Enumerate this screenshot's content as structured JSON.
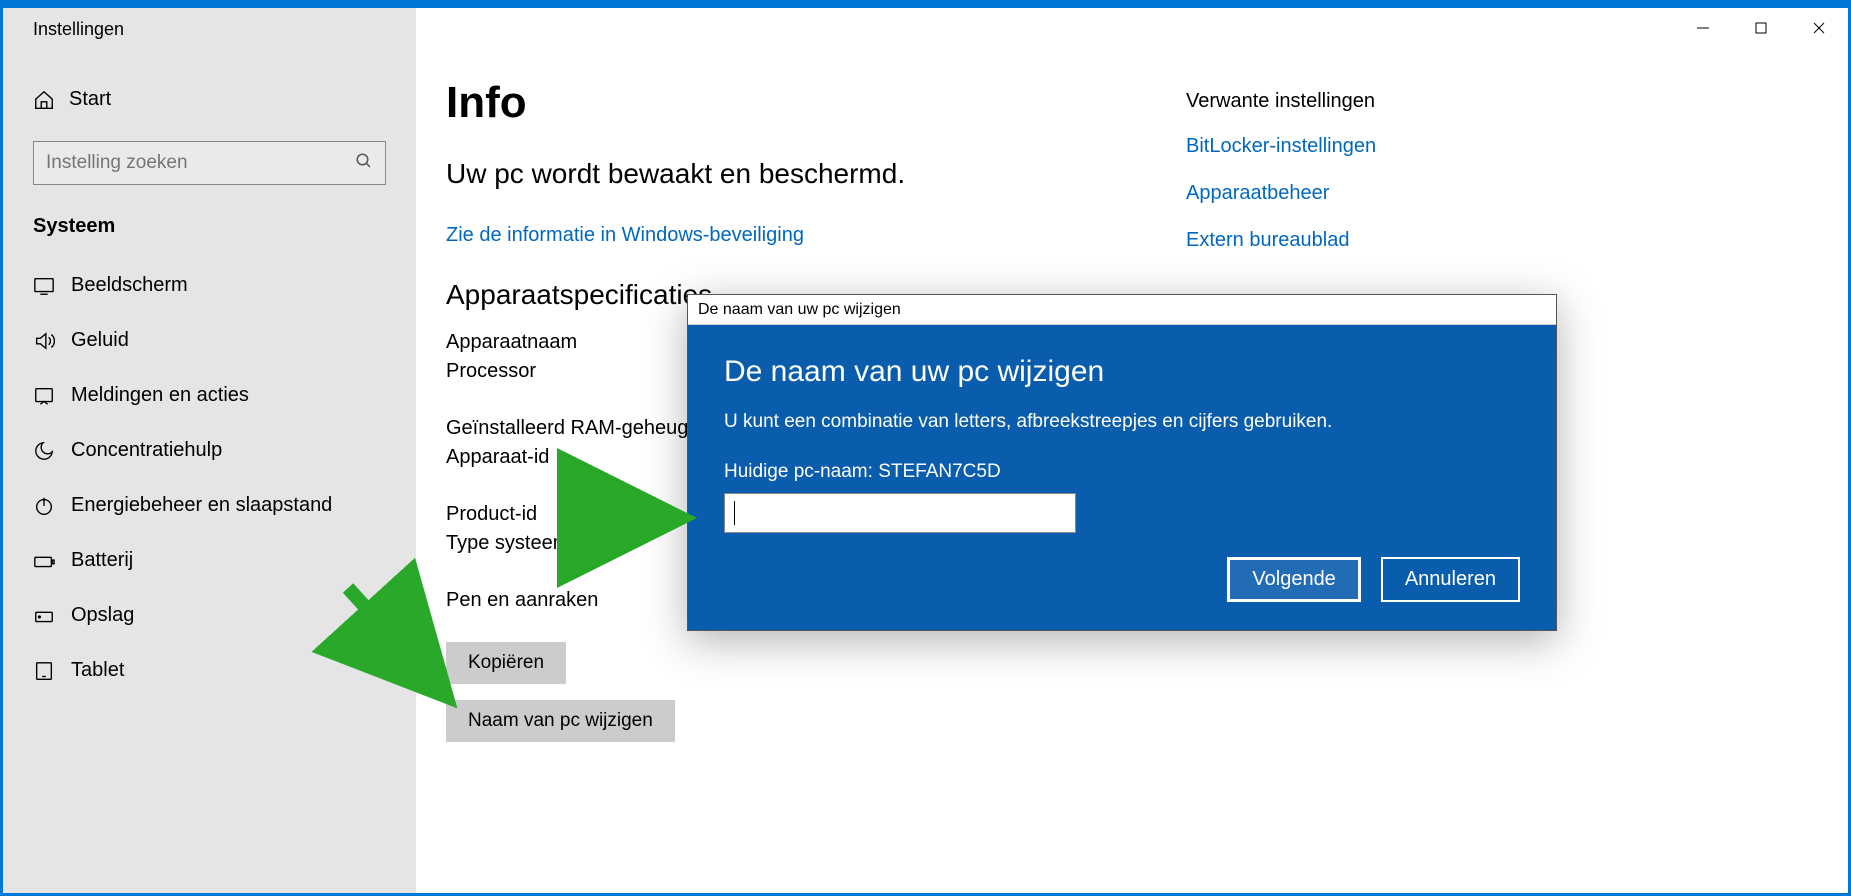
{
  "titlebar": {
    "title": "Instellingen"
  },
  "sidebar": {
    "home_label": "Start",
    "search_placeholder": "Instelling zoeken",
    "section_label": "Systeem",
    "items": [
      {
        "label": "Beeldscherm",
        "icon": "display"
      },
      {
        "label": "Geluid",
        "icon": "sound"
      },
      {
        "label": "Meldingen en acties",
        "icon": "notifications"
      },
      {
        "label": "Concentratiehulp",
        "icon": "moon"
      },
      {
        "label": "Energiebeheer en slaapstand",
        "icon": "power"
      },
      {
        "label": "Batterij",
        "icon": "battery"
      },
      {
        "label": "Opslag",
        "icon": "storage"
      },
      {
        "label": "Tablet",
        "icon": "tablet"
      }
    ]
  },
  "main": {
    "heading": "Info",
    "sub_heading": "Uw pc wordt bewaakt en beschermd.",
    "security_link": "Zie de informatie in Windows-beveiliging",
    "specs_heading": "Apparaatspecificaties",
    "specs": {
      "device_name": "Apparaatnaam",
      "processor": "Processor",
      "ram": "Geïnstalleerd RAM-geheugen",
      "device_id": "Apparaat-id",
      "product_id": "Product-id",
      "system_type": "Type systeem",
      "pen_touch": "Pen en aanraken"
    },
    "copy_btn": "Kopiëren",
    "rename_btn": "Naam van pc wijzigen"
  },
  "related": {
    "heading": "Verwante instellingen",
    "links": {
      "bitlocker": "BitLocker-instellingen",
      "device_manager": "Apparaatbeheer",
      "remote_desktop": "Extern bureaublad"
    }
  },
  "dialog": {
    "titlebar": "De naam van uw pc wijzigen",
    "heading": "De naam van uw pc wijzigen",
    "description": "U kunt een combinatie van letters, afbreekstreepjes en cijfers gebruiken.",
    "current_name_label": "Huidige pc-naam: STEFAN7C5D",
    "input_value": "",
    "next_btn": "Volgende",
    "cancel_btn": "Annuleren"
  }
}
